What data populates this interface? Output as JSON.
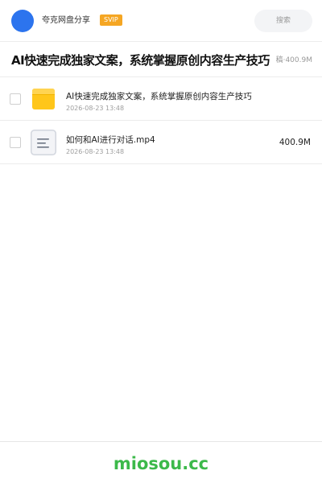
{
  "header": {
    "user_name": "夸克网盘分享",
    "badge": "SVIP",
    "search_placeholder": "搜索"
  },
  "folder": {
    "title": "AI快速完成独家文案，系统掌握原创内容生产技巧",
    "meta": "·400.9M",
    "meta_overlap": "稿"
  },
  "files": [
    {
      "name": "AI快速完成独家文案，系统掌握原创内容生产技巧",
      "date": "2026-08-23 13:48",
      "size": "",
      "icon": "folder-icon"
    },
    {
      "name": "如何和AI进行对话.mp4",
      "date": "2026-08-23 13:48",
      "size": "400.9M",
      "icon": "document-icon"
    }
  ],
  "footer": {
    "brand": "miosou.cc",
    "brand_color": "#3cb94a"
  },
  "colors": {
    "avatar": "#2c74ee",
    "badge": "#f5a623",
    "folder": "#ffc61a"
  }
}
